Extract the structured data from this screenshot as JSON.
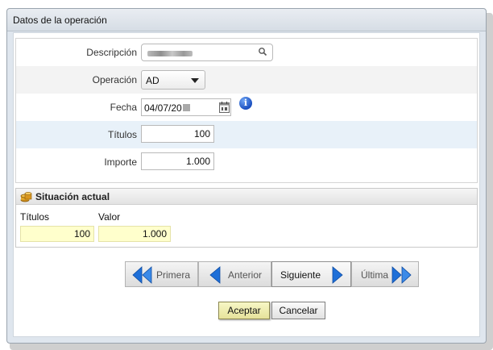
{
  "dialog": {
    "title": "Datos de la operación"
  },
  "form": {
    "descripcion": {
      "label": "Descripción"
    },
    "operacion": {
      "label": "Operación",
      "selected": "AD"
    },
    "fecha": {
      "label": "Fecha",
      "value": "04/07/20"
    },
    "titulos": {
      "label": "Títulos",
      "value": "100"
    },
    "importe": {
      "label": "Importe",
      "value": "1.000"
    }
  },
  "situacion": {
    "title": "Situación actual",
    "titulos_label": "Títulos",
    "titulos_value": "100",
    "valor_label": "Valor",
    "valor_value": "1.000"
  },
  "navigation": {
    "first": "Primera",
    "previous": "Anterior",
    "next": "Siguiente",
    "last": "Última"
  },
  "actions": {
    "accept": "Aceptar",
    "cancel": "Cancelar"
  },
  "colors": {
    "accent_blue": "#1e6fd8",
    "highlight_yellow": "#ffffcc",
    "row_highlight": "#e8f1f9"
  }
}
